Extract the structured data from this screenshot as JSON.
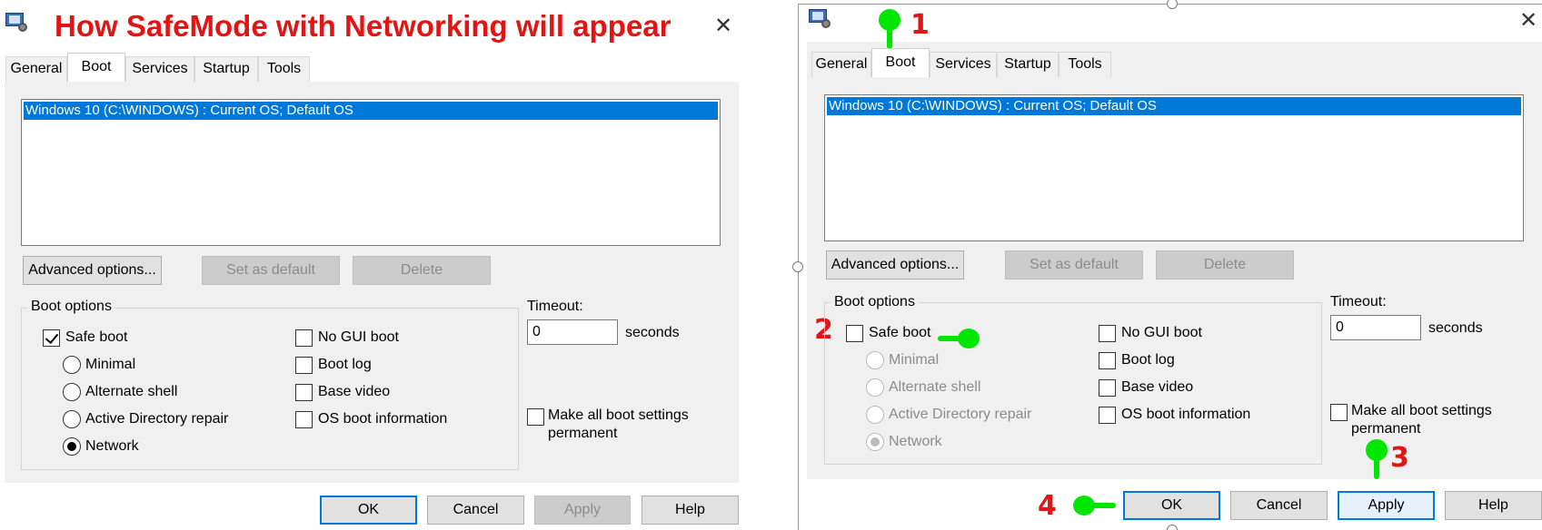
{
  "left": {
    "annotation_title": "How SafeMode with Networking will appear",
    "tabs": [
      "General",
      "Boot",
      "Services",
      "Startup",
      "Tools"
    ],
    "active_tab": "Boot",
    "os_entry": "Windows 10 (C:\\WINDOWS) : Current OS; Default OS",
    "buttons": {
      "advanced": "Advanced options...",
      "set_default": "Set as default",
      "delete": "Delete"
    },
    "boot_options_label": "Boot options",
    "safe_boot": {
      "label": "Safe boot",
      "checked": true
    },
    "radios": [
      {
        "label": "Minimal",
        "checked": false
      },
      {
        "label": "Alternate shell",
        "checked": false
      },
      {
        "label": "Active Directory repair",
        "checked": false
      },
      {
        "label": "Network",
        "checked": true
      }
    ],
    "right_checks": [
      "No GUI boot",
      "Boot log",
      "Base video",
      "OS boot information"
    ],
    "timeout": {
      "label": "Timeout:",
      "value": "0",
      "unit": "seconds"
    },
    "permanent": {
      "line1": "Make all boot settings",
      "line2": "permanent"
    },
    "bottom_buttons": {
      "ok": "OK",
      "cancel": "Cancel",
      "apply": "Apply",
      "help": "Help"
    }
  },
  "right": {
    "annotations": {
      "n1": "1",
      "n2": "2",
      "n3": "3",
      "n4": "4"
    },
    "tabs": [
      "General",
      "Boot",
      "Services",
      "Startup",
      "Tools"
    ],
    "active_tab": "Boot",
    "os_entry": "Windows 10 (C:\\WINDOWS) : Current OS; Default OS",
    "buttons": {
      "advanced": "Advanced options...",
      "set_default": "Set as default",
      "delete": "Delete"
    },
    "boot_options_label": "Boot options",
    "safe_boot": {
      "label": "Safe boot",
      "checked": false
    },
    "radios": [
      {
        "label": "Minimal",
        "checked": false
      },
      {
        "label": "Alternate shell",
        "checked": false
      },
      {
        "label": "Active Directory repair",
        "checked": false
      },
      {
        "label": "Network",
        "checked": true
      }
    ],
    "right_checks": [
      "No GUI boot",
      "Boot log",
      "Base video",
      "OS boot information"
    ],
    "timeout": {
      "label": "Timeout:",
      "value": "0",
      "unit": "seconds"
    },
    "permanent": {
      "line1": "Make all boot settings",
      "line2": "permanent"
    },
    "bottom_buttons": {
      "ok": "OK",
      "cancel": "Cancel",
      "apply": "Apply",
      "help": "Help"
    }
  },
  "colors": {
    "annotation_red": "#e31414",
    "pointer_green": "#00e600",
    "selection_blue": "#0078d7"
  },
  "icons": {
    "window": "msconfig-icon",
    "pointer": "pointing-hand-icon"
  }
}
